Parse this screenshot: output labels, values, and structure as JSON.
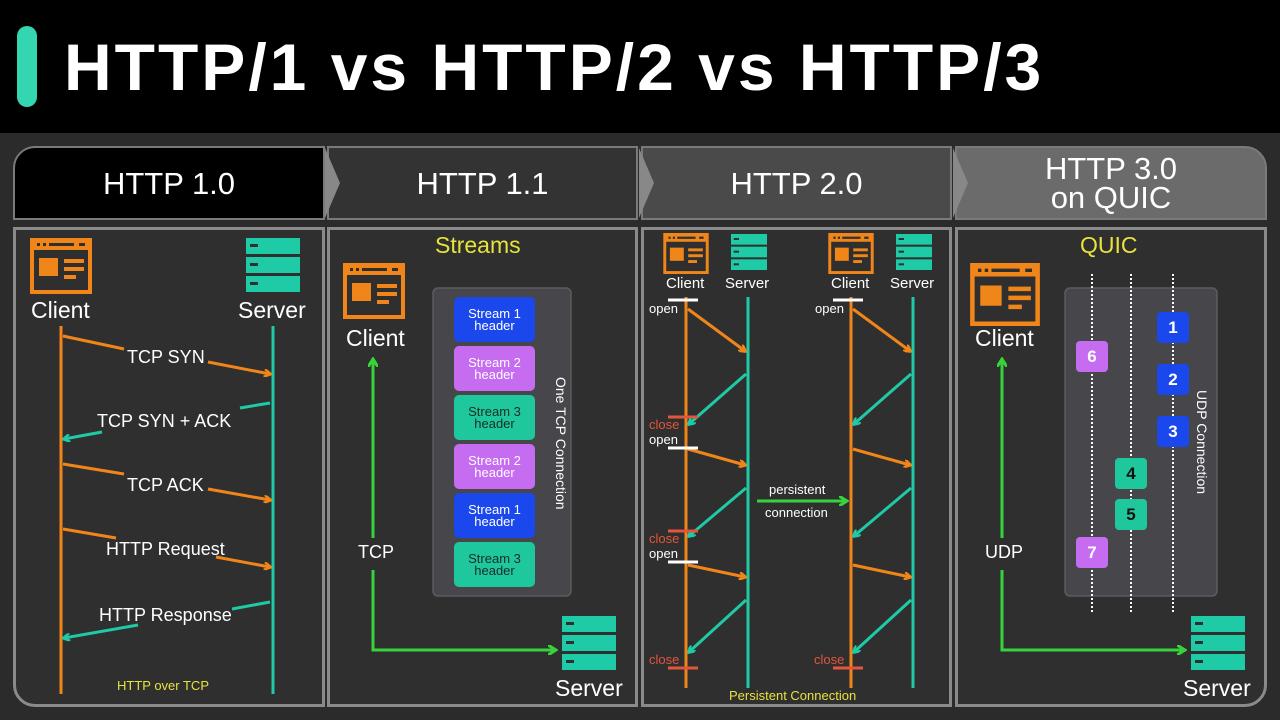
{
  "title": "HTTP/1 vs HTTP/2 vs HTTP/3",
  "tabs": [
    {
      "label_line1": "HTTP 1.0",
      "label_line2": ""
    },
    {
      "label_line1": "HTTP 1.1",
      "label_line2": ""
    },
    {
      "label_line1": "HTTP 2.0",
      "label_line2": ""
    },
    {
      "label_line1": "HTTP 3.0",
      "label_line2": "on QUIC"
    }
  ],
  "colors": {
    "accent": "#34d6b2",
    "client": "#f0861a",
    "server": "#1fcaa6",
    "green": "#37d33a",
    "yellow": "#e8e23c",
    "close": "#e2563c",
    "stream_blue": "#1a48ec",
    "stream_purple": "#c56cf0",
    "stream_teal": "#1fc89c"
  },
  "http10": {
    "client": "Client",
    "server": "Server",
    "messages": [
      "TCP SYN",
      "TCP SYN + ACK",
      "TCP ACK",
      "HTTP Request",
      "HTTP Response"
    ],
    "caption": "HTTP over TCP"
  },
  "http11": {
    "heading": "Streams",
    "client": "Client",
    "server": "Server",
    "link": "TCP",
    "connection_label": "One TCP Connection",
    "streams": [
      {
        "line1": "Stream 1",
        "line2": "header",
        "color": "blue"
      },
      {
        "line1": "Stream 2",
        "line2": "header",
        "color": "purple"
      },
      {
        "line1": "Stream 3",
        "line2": "header",
        "color": "teal"
      },
      {
        "line1": "Stream 2",
        "line2": "header",
        "color": "purple"
      },
      {
        "line1": "Stream 1",
        "line2": "header",
        "color": "blue"
      },
      {
        "line1": "Stream 3",
        "line2": "header",
        "color": "teal"
      }
    ]
  },
  "http20": {
    "client": "Client",
    "server": "Server",
    "open": "open",
    "close": "close",
    "persistent_line1": "persistent",
    "persistent_line2": "connection",
    "caption": "Persistent Connection"
  },
  "http30": {
    "heading": "QUIC",
    "client": "Client",
    "server": "Server",
    "link": "UDP",
    "connection_label": "UDP Connection",
    "packets": [
      {
        "n": "1",
        "lane": 3,
        "color": "blue"
      },
      {
        "n": "6",
        "lane": 1,
        "color": "purple"
      },
      {
        "n": "2",
        "lane": 3,
        "color": "blue"
      },
      {
        "n": "3",
        "lane": 3,
        "color": "blue"
      },
      {
        "n": "4",
        "lane": 2,
        "color": "teal"
      },
      {
        "n": "5",
        "lane": 2,
        "color": "teal"
      },
      {
        "n": "7",
        "lane": 1,
        "color": "purple"
      }
    ]
  }
}
